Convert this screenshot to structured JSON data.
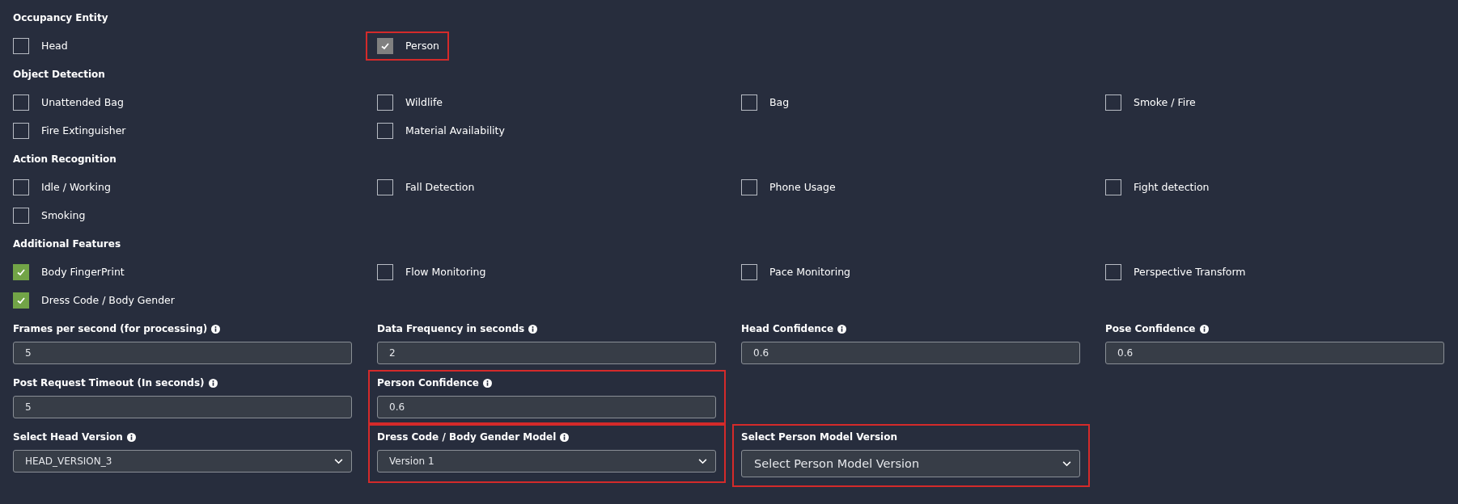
{
  "sections": [
    {
      "title": "Occupancy Entity",
      "options": [
        {
          "label": "Head",
          "checked": false,
          "disabled": false,
          "highlighted": false
        },
        {
          "label": "Person",
          "checked": true,
          "disabled": true,
          "highlighted": true
        }
      ]
    },
    {
      "title": "Object Detection",
      "options": [
        {
          "label": "Unattended Bag",
          "checked": false,
          "disabled": false,
          "highlighted": false
        },
        {
          "label": "Wildlife",
          "checked": false,
          "disabled": false,
          "highlighted": false
        },
        {
          "label": "Bag",
          "checked": false,
          "disabled": false,
          "highlighted": false
        },
        {
          "label": "Smoke / Fire",
          "checked": false,
          "disabled": false,
          "highlighted": false
        },
        {
          "label": "Fire Extinguisher",
          "checked": false,
          "disabled": false,
          "highlighted": false
        },
        {
          "label": "Material Availability",
          "checked": false,
          "disabled": false,
          "highlighted": false
        }
      ]
    },
    {
      "title": "Action Recognition",
      "options": [
        {
          "label": "Idle / Working",
          "checked": false,
          "disabled": false,
          "highlighted": false
        },
        {
          "label": "Fall Detection",
          "checked": false,
          "disabled": false,
          "highlighted": false
        },
        {
          "label": "Phone Usage",
          "checked": false,
          "disabled": false,
          "highlighted": false
        },
        {
          "label": "Fight detection",
          "checked": false,
          "disabled": false,
          "highlighted": false
        },
        {
          "label": "Smoking",
          "checked": false,
          "disabled": false,
          "highlighted": false
        }
      ]
    },
    {
      "title": "Additional Features",
      "options": [
        {
          "label": "Body FingerPrint",
          "checked": true,
          "disabled": false,
          "highlighted": false
        },
        {
          "label": "Flow Monitoring",
          "checked": false,
          "disabled": false,
          "highlighted": false
        },
        {
          "label": "Pace Monitoring",
          "checked": false,
          "disabled": false,
          "highlighted": false
        },
        {
          "label": "Perspective Transform",
          "checked": false,
          "disabled": false,
          "highlighted": false
        },
        {
          "label": "Dress Code / Body Gender",
          "checked": true,
          "disabled": false,
          "highlighted": false
        }
      ]
    }
  ],
  "field_rows": [
    [
      {
        "kind": "input",
        "label": "Frames per second (for processing)",
        "info": true,
        "value": "5",
        "highlighted": false
      },
      {
        "kind": "input",
        "label": "Data Frequency in seconds",
        "info": true,
        "value": "2",
        "highlighted": false
      },
      {
        "kind": "input",
        "label": "Head Confidence",
        "info": true,
        "value": "0.6",
        "highlighted": false
      },
      {
        "kind": "input",
        "label": "Pose Confidence",
        "info": true,
        "value": "0.6",
        "highlighted": false
      }
    ],
    [
      {
        "kind": "input",
        "label": "Post Request Timeout (In seconds)",
        "info": true,
        "value": "5",
        "highlighted": false
      },
      {
        "kind": "input",
        "label": "Person Confidence",
        "info": true,
        "value": "0.6",
        "highlighted": true
      }
    ],
    [
      {
        "kind": "select",
        "label": "Select Head Version",
        "info": true,
        "value": "HEAD_VERSION_3",
        "highlighted": false
      },
      {
        "kind": "select",
        "label": "Dress Code / Body Gender Model",
        "info": true,
        "value": "Version 1",
        "highlighted": true
      },
      {
        "kind": "select-large",
        "label": "Select Person Model Version",
        "info": false,
        "value": "Select Person Model Version",
        "highlighted": true
      }
    ]
  ]
}
